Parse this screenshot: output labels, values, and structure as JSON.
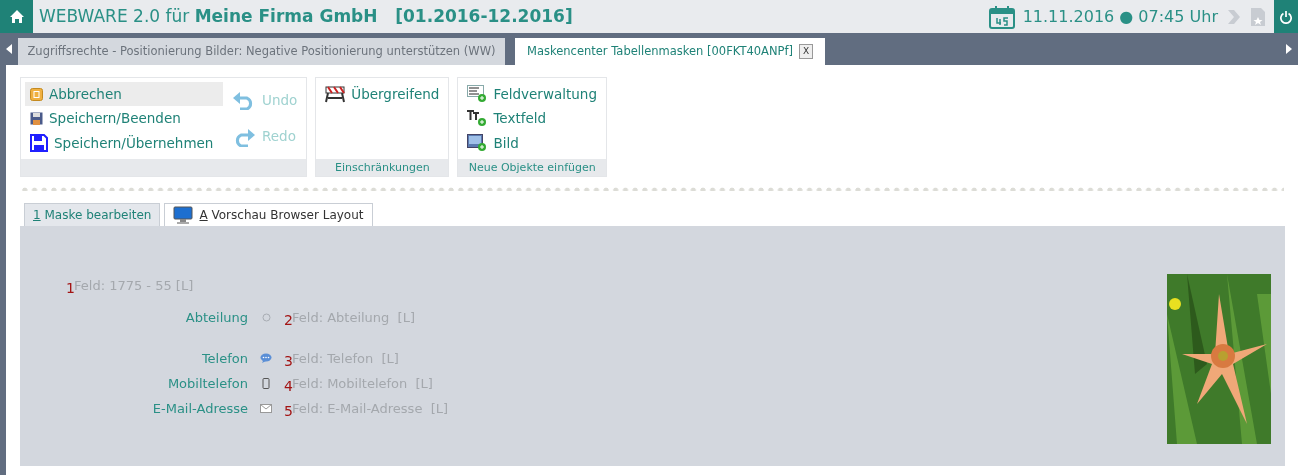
{
  "header": {
    "product": "WEBWARE 2.0 für",
    "company": "Meine Firma GmbH",
    "period": "[01.2016-12.2016]",
    "date": "11.11.2016",
    "separator": "●",
    "time": "07:45 Uhr"
  },
  "doc_tabs": [
    {
      "label": "Zugriffsrechte - Positionierung Bilder: Negative Positionierung unterstützen (WW)",
      "selected": false
    },
    {
      "label": "Maskencenter Tabellenmasken [00FKT40ANPf]",
      "selected": true,
      "close_label": "X"
    }
  ],
  "ribbon": [
    {
      "columns": [
        [
          {
            "label": "Abbrechen",
            "highlighted": true,
            "disabled": false
          },
          {
            "label": "Speichern/Beenden",
            "highlighted": false,
            "disabled": false
          },
          {
            "label": "Speichern/Übernehmen",
            "highlighted": false,
            "disabled": false
          }
        ],
        [
          {
            "label": "Undo",
            "highlighted": false,
            "disabled": true
          },
          {
            "label": "Redo",
            "highlighted": false,
            "disabled": true
          }
        ]
      ]
    },
    {
      "caption": "Einschränkungen",
      "columns": [
        [
          {
            "label": "Übergreifend",
            "highlighted": false,
            "disabled": false
          }
        ]
      ]
    },
    {
      "caption": "Neue Objekte einfügen",
      "columns": [
        [
          {
            "label": "Feldverwaltung",
            "highlighted": false,
            "disabled": false
          },
          {
            "label": "Textfeld",
            "highlighted": false,
            "disabled": false
          },
          {
            "label": "Bild",
            "highlighted": false,
            "disabled": false
          }
        ]
      ]
    }
  ],
  "form_tabs": [
    {
      "hotkey": "1",
      "label": "Maske bearbeiten",
      "selected": true
    },
    {
      "hotkey": "A",
      "label": "Vorschau Browser Layout",
      "selected": false
    }
  ],
  "fields": [
    {
      "kind": "title",
      "marker": "1",
      "text": "Feld: 1775 - 55 [L]"
    },
    {
      "kind": "field",
      "label": "Abteilung",
      "marker": "2",
      "text": "Feld: Abteilung  [L]"
    },
    {
      "kind": "field",
      "label": "Telefon",
      "marker": "3",
      "text": "Feld: Telefon  [L]"
    },
    {
      "kind": "field",
      "label": "Mobiltelefon",
      "marker": "4",
      "text": "Feld: Mobiltelefon  [L]"
    },
    {
      "kind": "field",
      "label": "E-Mail-Adresse",
      "marker": "5",
      "text": "Feld: E-Mail-Adresse  [L]"
    }
  ]
}
